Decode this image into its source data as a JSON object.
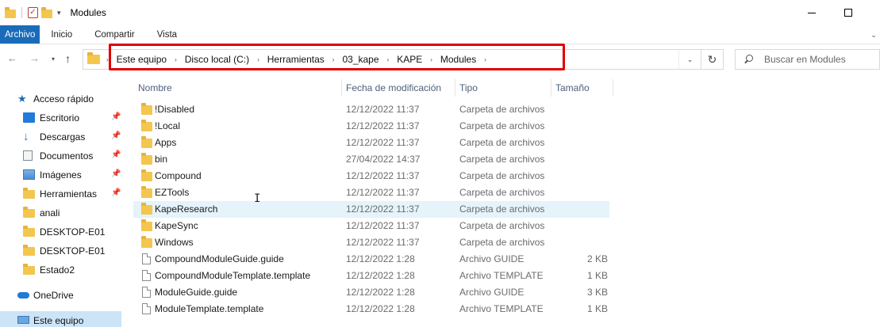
{
  "window": {
    "title": "Modules"
  },
  "ribbon": {
    "tabs": [
      "Archivo",
      "Inicio",
      "Compartir",
      "Vista"
    ]
  },
  "address": {
    "crumbs": [
      "Este equipo",
      "Disco local (C:)",
      "Herramientas",
      "03_kape",
      "KAPE",
      "Modules"
    ]
  },
  "search": {
    "placeholder": "Buscar en Modules"
  },
  "nav": {
    "quick_access": "Acceso rápido",
    "items": [
      "Escritorio",
      "Descargas",
      "Documentos",
      "Imágenes",
      "Herramientas",
      "anali",
      "DESKTOP-E01",
      "DESKTOP-E01",
      "Estado2"
    ],
    "onedrive": "OneDrive",
    "this_pc": "Este equipo"
  },
  "columns": {
    "name": "Nombre",
    "date": "Fecha de modificación",
    "type": "Tipo",
    "size": "Tamaño"
  },
  "files": [
    {
      "name": "!Disabled",
      "date": "12/12/2022 11:37",
      "type": "Carpeta de archivos",
      "size": ""
    },
    {
      "name": "!Local",
      "date": "12/12/2022 11:37",
      "type": "Carpeta de archivos",
      "size": ""
    },
    {
      "name": "Apps",
      "date": "12/12/2022 11:37",
      "type": "Carpeta de archivos",
      "size": ""
    },
    {
      "name": "bin",
      "date": "27/04/2022 14:37",
      "type": "Carpeta de archivos",
      "size": ""
    },
    {
      "name": "Compound",
      "date": "12/12/2022 11:37",
      "type": "Carpeta de archivos",
      "size": ""
    },
    {
      "name": "EZTools",
      "date": "12/12/2022 11:37",
      "type": "Carpeta de archivos",
      "size": ""
    },
    {
      "name": "KapeResearch",
      "date": "12/12/2022 11:37",
      "type": "Carpeta de archivos",
      "size": ""
    },
    {
      "name": "KapeSync",
      "date": "12/12/2022 11:37",
      "type": "Carpeta de archivos",
      "size": ""
    },
    {
      "name": "Windows",
      "date": "12/12/2022 11:37",
      "type": "Carpeta de archivos",
      "size": ""
    },
    {
      "name": "CompoundModuleGuide.guide",
      "date": "12/12/2022 1:28",
      "type": "Archivo GUIDE",
      "size": "2 KB"
    },
    {
      "name": "CompoundModuleTemplate.template",
      "date": "12/12/2022 1:28",
      "type": "Archivo TEMPLATE",
      "size": "1 KB"
    },
    {
      "name": "ModuleGuide.guide",
      "date": "12/12/2022 1:28",
      "type": "Archivo GUIDE",
      "size": "3 KB"
    },
    {
      "name": "ModuleTemplate.template",
      "date": "12/12/2022 1:28",
      "type": "Archivo TEMPLATE",
      "size": "1 KB"
    }
  ],
  "colors": {
    "accent": "#1a6bb8",
    "highlight_box": "#e00000",
    "folder": "#f3c64f"
  }
}
